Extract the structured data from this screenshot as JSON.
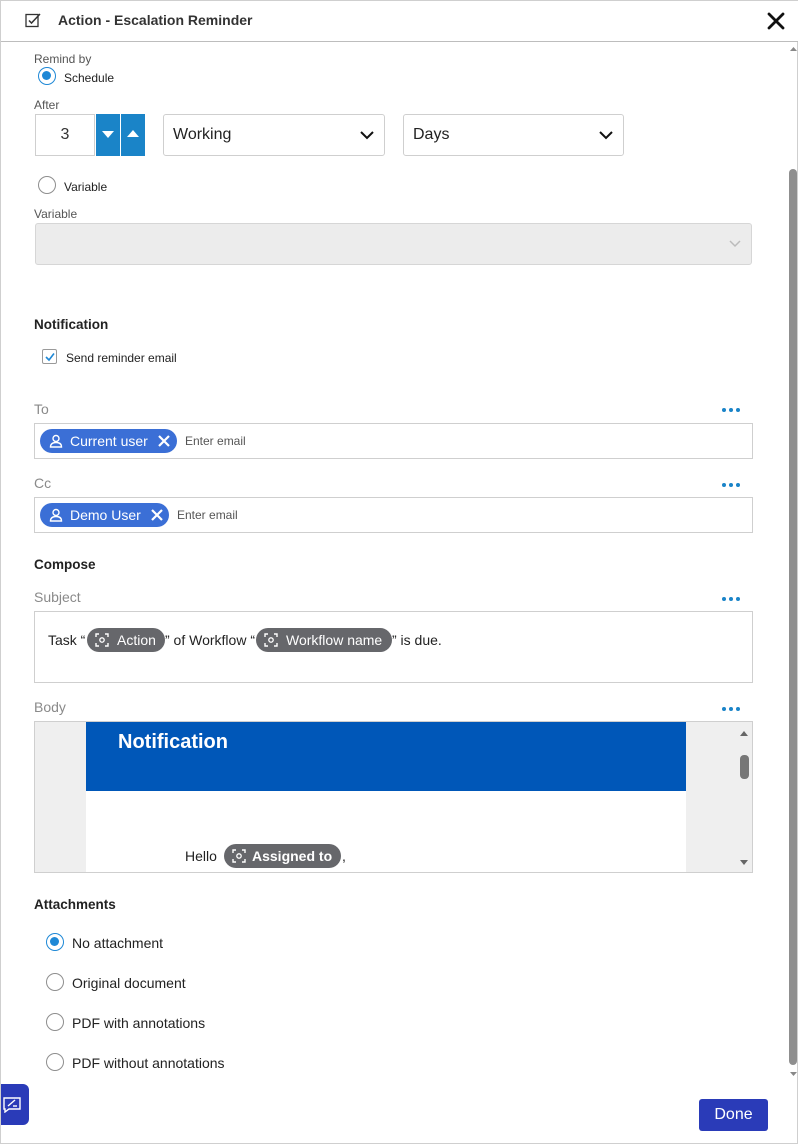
{
  "header": {
    "title": "Action - Escalation Reminder",
    "icon": "edit-check-icon",
    "close_icon": "close-icon"
  },
  "remind": {
    "label": "Remind by",
    "schedule_label": "Schedule",
    "schedule_selected": true,
    "after_label": "After",
    "after_value": "3",
    "day_type": "Working",
    "unit": "Days",
    "variable_radio_label": "Variable",
    "variable_selected": false,
    "variable_field_label": "Variable",
    "variable_value": ""
  },
  "notification": {
    "title": "Notification",
    "send_email_label": "Send reminder email",
    "send_email_checked": true
  },
  "to": {
    "label": "To",
    "chips": [
      "Current user"
    ],
    "placeholder": "Enter email"
  },
  "cc": {
    "label": "Cc",
    "chips": [
      "Demo User"
    ],
    "placeholder": "Enter email"
  },
  "compose": {
    "title": "Compose",
    "subject_label": "Subject",
    "subject": {
      "part1": "Task “",
      "token1": "Action",
      "part2": "” of Workflow “",
      "token2": "Workflow name",
      "part3": "” is due."
    },
    "body_label": "Body",
    "body": {
      "banner_title": "Notification",
      "hello": "Hello",
      "token": "Assigned to",
      "after_token": ","
    }
  },
  "attachments": {
    "title": "Attachments",
    "options": [
      "No attachment",
      "Original document",
      "PDF with annotations",
      "PDF without annotations"
    ],
    "selected": "No attachment"
  },
  "footer": {
    "done_label": "Done",
    "feedback_icon": "feedback-icon"
  },
  "colors": {
    "accent": "#1a84c8",
    "chip": "#3b6fd6",
    "banner": "#0057b8",
    "token": "#66676b",
    "done": "#2a3bb8"
  }
}
